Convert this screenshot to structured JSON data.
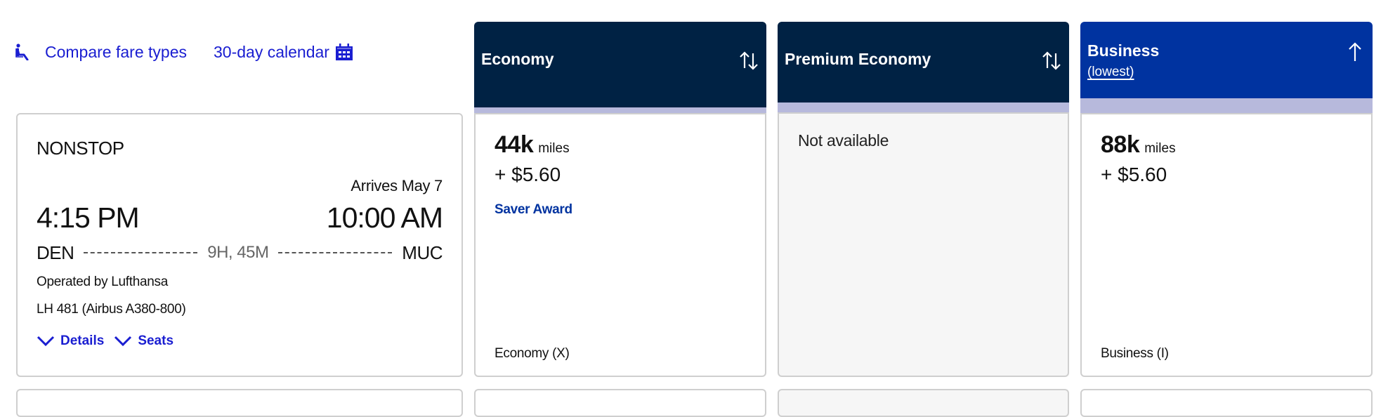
{
  "top_links": {
    "compare_fare_types": "Compare fare types",
    "calendar": "30-day calendar",
    "compare_icon": "seat-icon",
    "calendar_icon": "calendar-icon"
  },
  "flight": {
    "stops": "NONSTOP",
    "arrives": "Arrives May 7",
    "departure_time": "4:15 PM",
    "arrival_time": "10:00 AM",
    "origin": "DEN",
    "destination": "MUC",
    "duration": "9H, 45M",
    "operated_by": "Operated by Lufthansa",
    "flight_number": "LH 481 (Airbus A380-800)",
    "details_label": "Details",
    "seats_label": "Seats"
  },
  "columns": [
    {
      "title": "Economy",
      "subtitle": "",
      "sort_icon": "sort-both-icon",
      "header_color": "#002244",
      "miles": "44k",
      "miles_unit": "miles",
      "fee": "+ $5.60",
      "award": "Saver Award",
      "fare_class": "Economy (X)"
    },
    {
      "title": "Premium Economy",
      "subtitle": "",
      "sort_icon": "sort-both-icon",
      "header_color": "#002244",
      "status": "Not available"
    },
    {
      "title": "Business",
      "subtitle": "(lowest)",
      "sort_icon": "sort-up-icon",
      "header_color": "#0033a0",
      "miles": "88k",
      "miles_unit": "miles",
      "fee": "+ $5.60",
      "fare_class": "Business (I)"
    }
  ],
  "colors": {
    "link": "#1a1ed1",
    "header_dark": "#002244",
    "header_selected": "#0033a0",
    "strip": "#b7b9dc",
    "unavailable_bg": "#f6f6f6"
  }
}
